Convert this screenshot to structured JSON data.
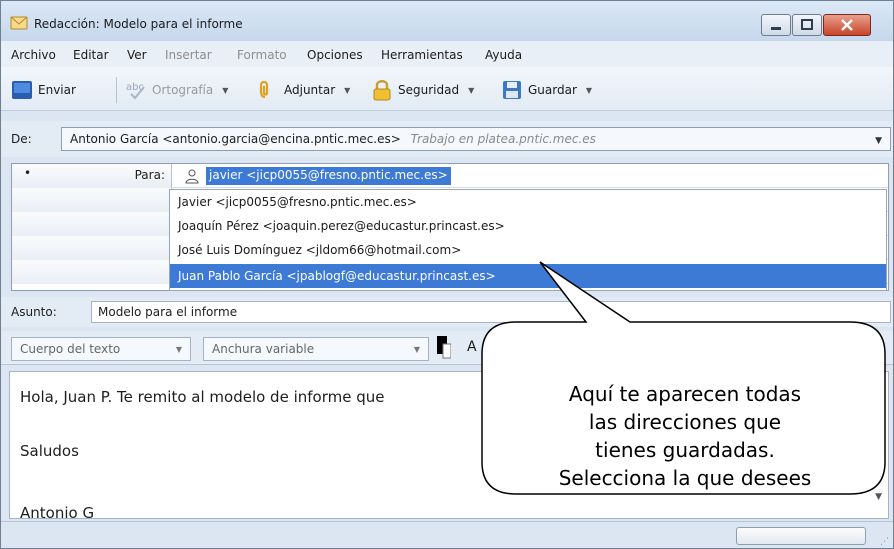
{
  "window": {
    "title": "Redacción: Modelo para el informe"
  },
  "menu": [
    {
      "label": "Archivo",
      "enabled": true
    },
    {
      "label": "Editar",
      "enabled": true
    },
    {
      "label": "Ver",
      "enabled": true
    },
    {
      "label": "Insertar",
      "enabled": false
    },
    {
      "label": "Formato",
      "enabled": false
    },
    {
      "label": "Opciones",
      "enabled": true
    },
    {
      "label": "Herramientas",
      "enabled": true
    },
    {
      "label": "Ayuda",
      "enabled": true
    }
  ],
  "toolbar": {
    "send": "Enviar",
    "spelling": "Ortografía",
    "attach": "Adjuntar",
    "security": "Seguridad",
    "save": "Guardar"
  },
  "from": {
    "label": "De:",
    "value": "Antonio García <antonio.garcia@encina.pntic.mec.es>",
    "account": "Trabajo en platea.pntic.mec.es"
  },
  "recipients": {
    "type_label": "Para:",
    "bullet": "•",
    "typed_value": "javier <jicp0055@fresno.pntic.mec.es>"
  },
  "autocomplete": [
    "Javier <jicp0055@fresno.pntic.mec.es>",
    "Joaquín Pérez <joaquin.perez@educastur.princast.es>",
    "José Luis Domínguez <jldom66@hotmail.com>",
    "Juan Pablo García <jpablogf@educastur.princast.es>"
  ],
  "selected_suggestion_index": 3,
  "subject": {
    "label": "Asunto:",
    "value": "Modelo para el informe"
  },
  "format": {
    "paragraph_style": "Cuerpo del texto",
    "font": "Anchura variable",
    "text_button": "A"
  },
  "body": {
    "lines": [
      "Hola, Juan P. Te remito al modelo de informe que",
      "Saludos",
      "Antonio G"
    ]
  },
  "callout": {
    "lines": [
      "Aquí te aparecen todas",
      "las direcciones que",
      "tienes guardadas.",
      "Selecciona la que desees"
    ]
  },
  "colors": {
    "selection": "#3c7ad6",
    "window_chrome": "#dce6f2",
    "close_button": "#c9452a"
  }
}
